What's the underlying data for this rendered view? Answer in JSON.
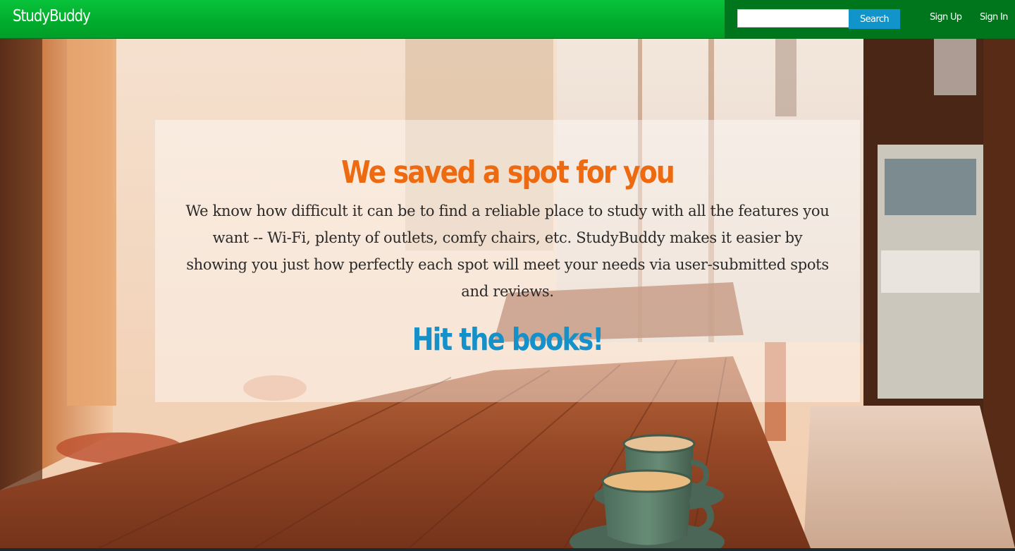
{
  "navbar": {
    "brand": "StudyBuddy",
    "search": {
      "placeholder": "",
      "value": "",
      "button_label": "Search"
    },
    "links": {
      "sign_up": "Sign Up",
      "sign_in": "Sign In"
    }
  },
  "hero": {
    "headline": "We saved a spot for you",
    "intro": "We know how difficult it can be to find a reliable place to study with all the features you want -- Wi-Fi, plenty of outlets, comfy chairs, etc. StudyBuddy makes it easier by showing you just how perfectly each spot will meet your needs via user-submitted spots and reviews.",
    "cta": "Hit the books!"
  },
  "colors": {
    "navbar_green": "#00ab2c",
    "nav_right_dark_green": "#00761c",
    "search_button_blue": "#1194c9",
    "headline_orange": "#ee6a10",
    "cta_blue": "#1590c8",
    "panel_overlay": "rgba(255,255,255,0.42)"
  },
  "background_image": "cafe interior with wooden table and coffee cups"
}
